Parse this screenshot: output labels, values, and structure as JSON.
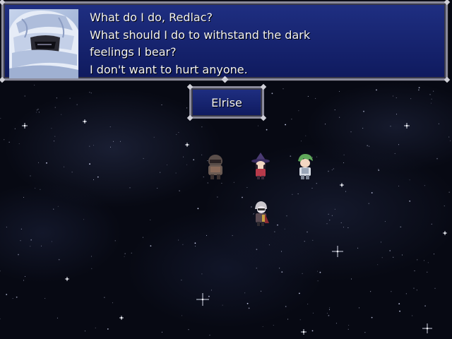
{
  "dialogue": {
    "lines": [
      "What do I do, Redlac?",
      "What should I do to withstand the dark",
      "feelings I bear?",
      "I don't want to hurt anyone."
    ]
  },
  "speaker": {
    "name": "Elrise"
  },
  "colors": {
    "window_fill": "#1f2f82",
    "window_border": "#8a8a9a",
    "text": "#f2f2f2",
    "space_bg": "#070913"
  },
  "portrait": {
    "icon": "hooded-masked-character-portrait"
  },
  "characters": [
    {
      "icon": "armored-knight-sprite"
    },
    {
      "icon": "witch-hat-girl-sprite"
    },
    {
      "icon": "green-haired-boy-sprite"
    },
    {
      "icon": "masked-hooded-figure-sprite"
    }
  ]
}
